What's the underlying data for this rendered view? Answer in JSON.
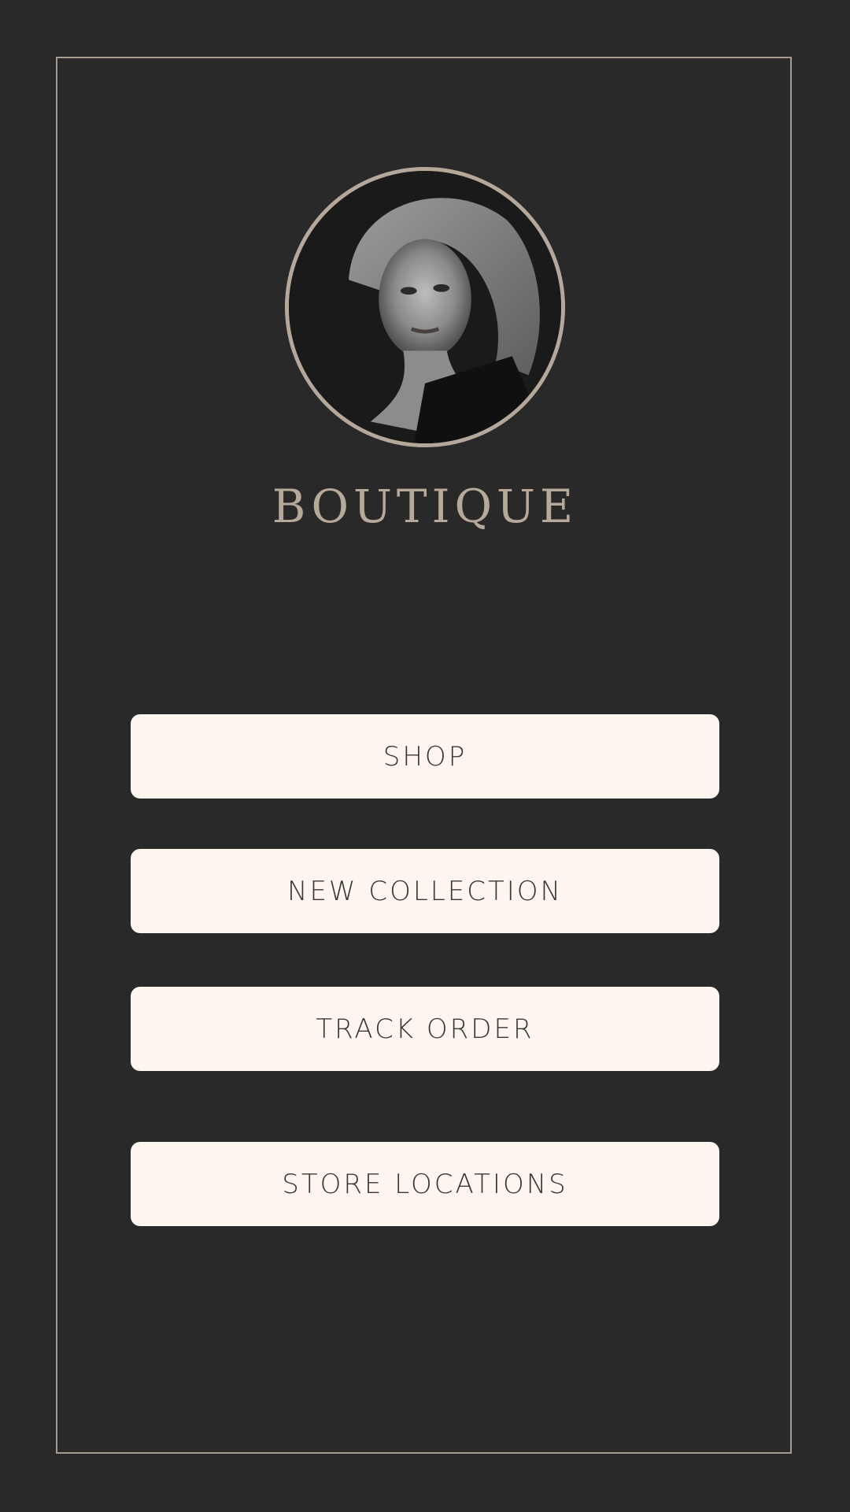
{
  "brand": {
    "title": "BOUTIQUE",
    "accent_color": "#b7a99a",
    "background_color": "#292929"
  },
  "avatar": {
    "icon": "portrait-photo"
  },
  "menu": {
    "buttons": [
      {
        "label": "SHOP"
      },
      {
        "label": "NEW COLLECTION"
      },
      {
        "label": "TRACK ORDER"
      },
      {
        "label": "STORE LOCATIONS"
      }
    ],
    "button_color": "#fcf6ee",
    "text_color": "#3a3633"
  }
}
